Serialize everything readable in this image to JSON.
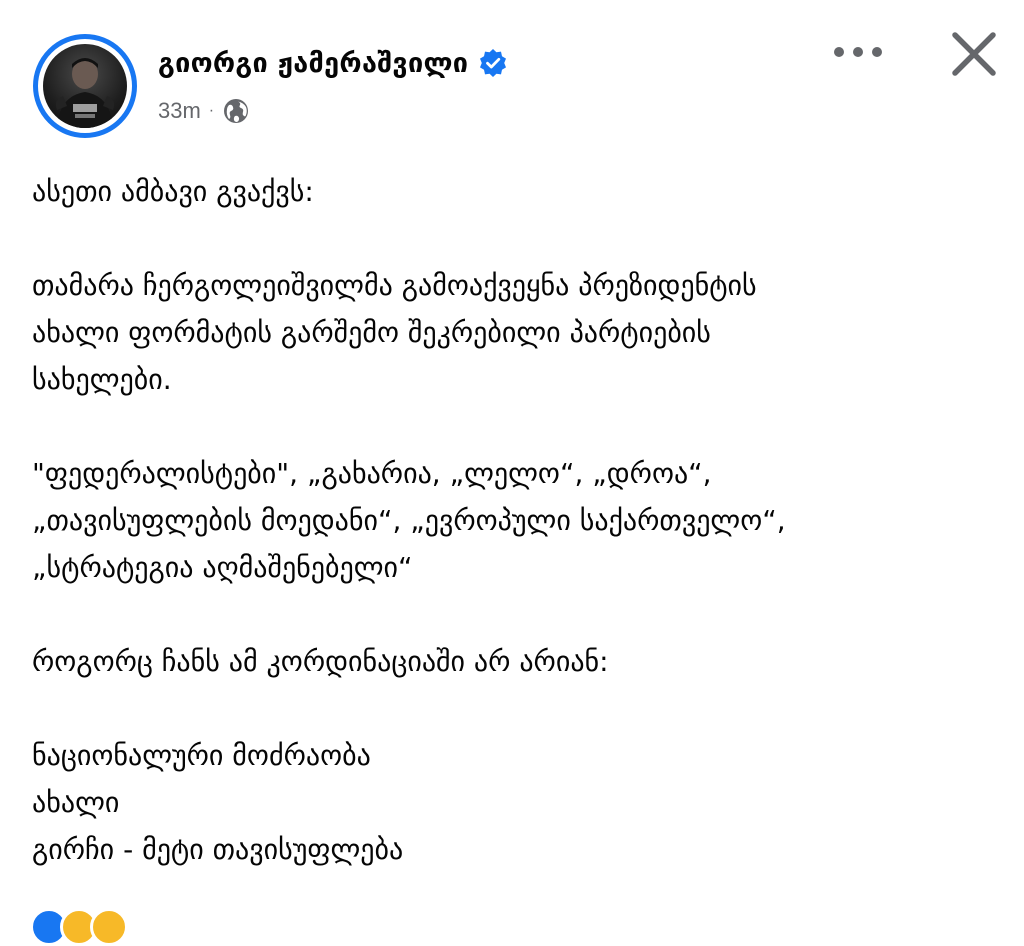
{
  "post": {
    "author_name": "გიორგი ჟამერაშვილი",
    "timestamp": "33m",
    "meta_separator": "·",
    "icons": {
      "verified": "verified-badge-icon",
      "audience": "globe-icon",
      "more": "more-options-icon",
      "close": "close-icon"
    },
    "colors": {
      "accent": "#1877f2",
      "meta_text": "#65676b",
      "body_text": "#050505"
    }
  },
  "content": {
    "paragraphs": [
      {
        "lines": [
          "ასეთი ამბავი გვაქვს:"
        ]
      },
      {
        "lines": [
          "თამარა ჩერგოლეიშვილმა გამოაქვეყნა პრეზიდენტის",
          "ახალი ფორმატის გარშემო შეკრებილი პარტიების",
          "სახელები."
        ]
      },
      {
        "lines": [
          "\"ფედერალისტები\", „გახარია, „ლელო“, „დროა“,",
          "„თავისუფლების მოედანი“, „ევროპული საქართველო“,",
          "„სტრატეგია აღმაშენებელი“"
        ]
      },
      {
        "lines": [
          "როგორც ჩანს ამ კორდინაციაში არ არიან:"
        ]
      },
      {
        "lines": [
          "ნაციონალური მოძრაობა",
          "ახალი",
          "გირჩი - მეტი თავისუფლება"
        ]
      }
    ]
  },
  "reactions": {
    "icons": [
      "like-reaction-icon",
      "haha-reaction-icon",
      "wow-reaction-icon"
    ],
    "colors": [
      "#1877f2",
      "#f7b928",
      "#f7b928"
    ]
  }
}
